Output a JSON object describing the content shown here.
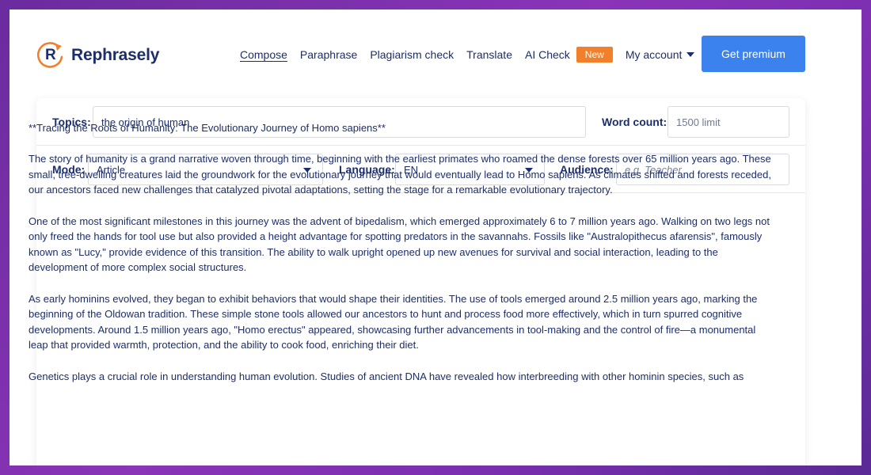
{
  "brand": {
    "name": "Rephrasely",
    "logo_letter": "R",
    "accent_orange": "#f2802b",
    "navy": "#1c2e6b",
    "blue": "#3c82ef"
  },
  "nav": {
    "items": [
      "Compose",
      "Paraphrase",
      "Plagiarism check",
      "Translate",
      "AI Check"
    ],
    "active": "Compose",
    "new_badge": "New",
    "account_label": "My account",
    "premium_button": "Get premium"
  },
  "form": {
    "topics_label": "Topics:",
    "topics_value": "the origin of human",
    "word_count_label": "Word count:",
    "word_count_placeholder": "1500 limit",
    "mode_label": "Mode:",
    "mode_value": "Article",
    "language_label": "Language:",
    "language_value": "EN",
    "audience_label": "Audience:",
    "audience_placeholder": "e.g. Teacher"
  },
  "output": {
    "paragraphs": [
      "**Tracing the Roots of Humanity: The Evolutionary Journey of Homo sapiens**",
      "The story of humanity is a grand narrative woven through time, beginning with the earliest primates who roamed the dense forests over 65 million years ago. These small, tree-dwelling creatures laid the groundwork for the evolutionary journey that would eventually lead to Homo sapiens. As climates shifted and forests receded, our ancestors faced new challenges that catalyzed pivotal adaptations, setting the stage for a remarkable evolutionary trajectory.",
      "One of the most significant milestones in this journey was the advent of bipedalism, which emerged approximately 6 to 7 million years ago. Walking on two legs not only freed the hands for tool use but also provided a height advantage for spotting predators in the savannahs. Fossils like \"Australopithecus afarensis\", famously known as \"Lucy,\" provide evidence of this transition. The ability to walk upright opened up new avenues for survival and social interaction, leading to the development of more complex social structures.",
      "As early hominins evolved, they began to exhibit behaviors that would shape their identities. The use of tools emerged around 2.5 million years ago, marking the beginning of the Oldowan tradition. These simple stone tools allowed our ancestors to hunt and process food more effectively, which in turn spurred cognitive developments. Around 1.5 million years ago, \"Homo erectus\" appeared, showcasing further advancements in tool-making and the control of fire—a monumental leap that provided warmth, protection, and the ability to cook food, enriching their diet.",
      "Genetics plays a crucial role in understanding human evolution. Studies of ancient DNA have revealed how interbreeding with other hominin species, such as"
    ]
  }
}
